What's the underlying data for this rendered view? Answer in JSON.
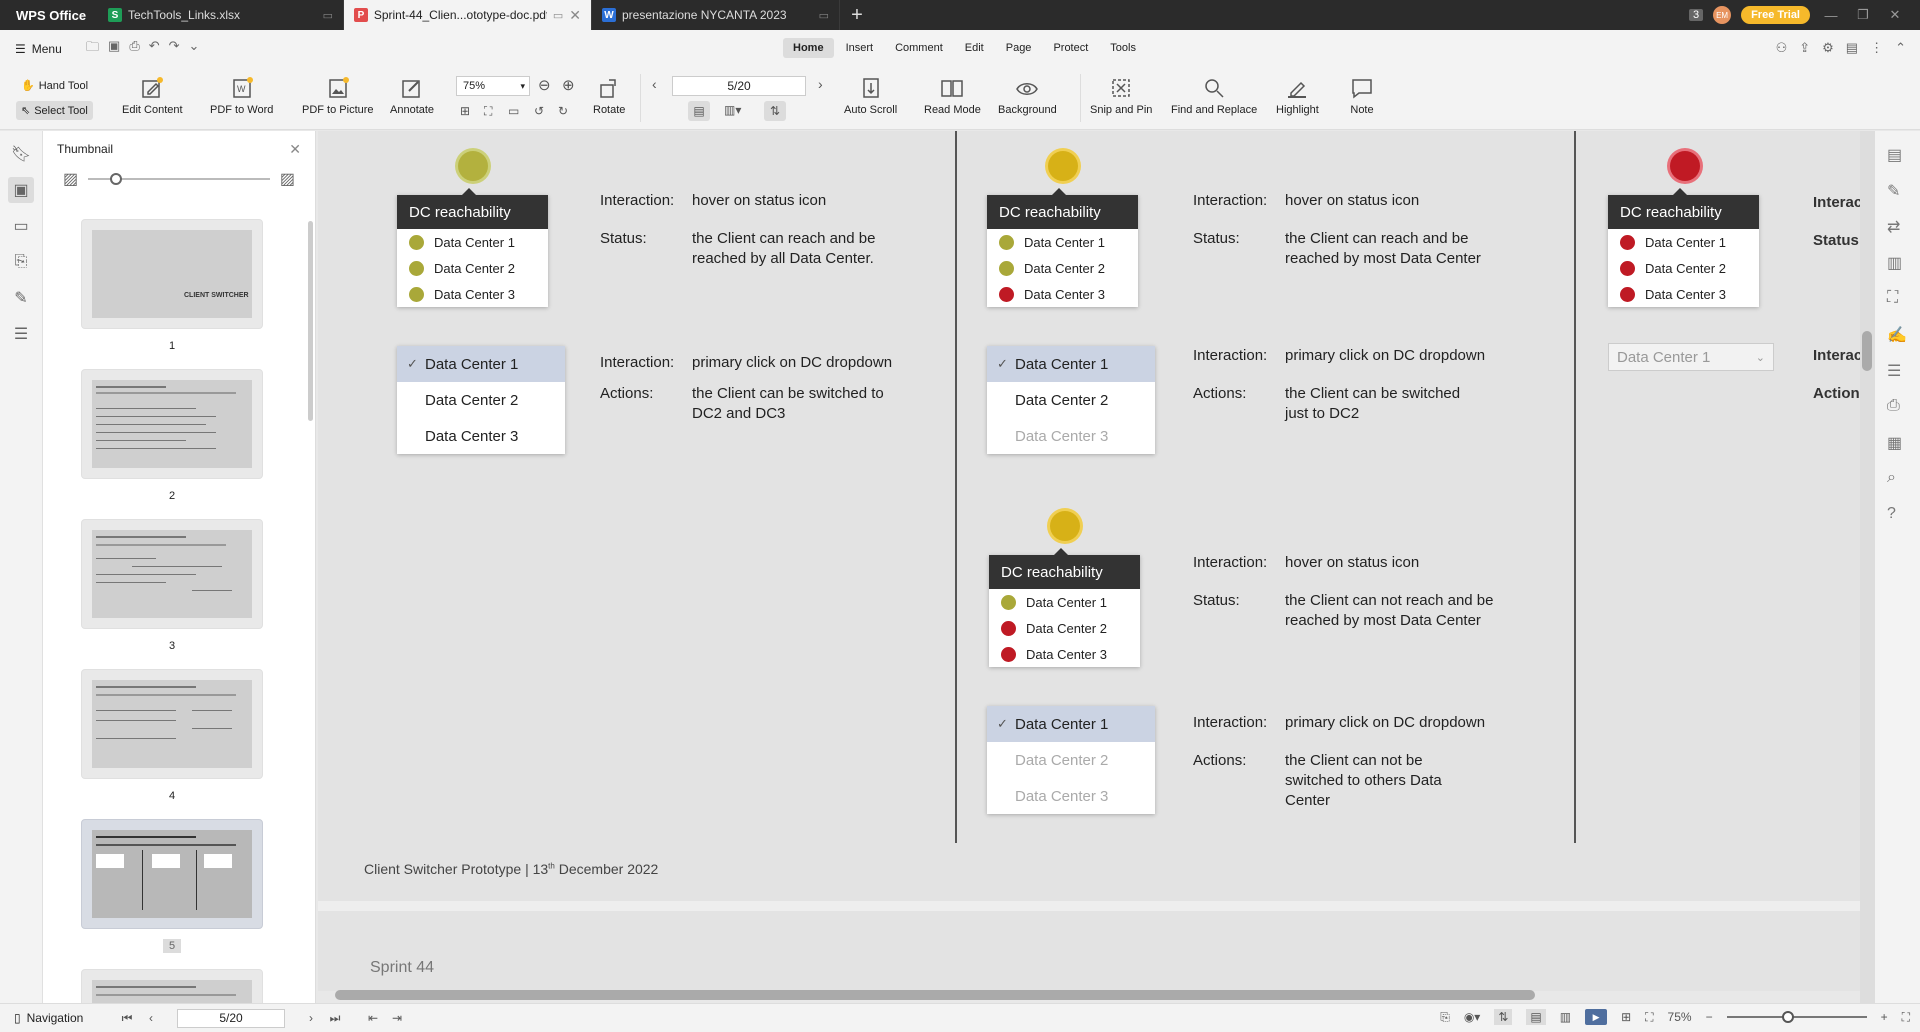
{
  "tabbar": {
    "app_name": "WPS Office",
    "tabs": [
      {
        "label": "TechTools_Links.xlsx",
        "icon": "spreadsheet-icon",
        "color": "#1e9d57"
      },
      {
        "label": "Sprint-44_Clien...ototype-doc.pdf",
        "icon": "pdf-icon",
        "color": "#e24d4d"
      },
      {
        "label": "presentazione NYCANTA 2023",
        "icon": "word-icon",
        "color": "#2b6fd6"
      }
    ],
    "window_count": "3",
    "avatar_initials": "EM",
    "free_trial": "Free Trial"
  },
  "menubar": {
    "menu_label": "Menu",
    "ribbon_tabs": [
      "Home",
      "Insert",
      "Comment",
      "Edit",
      "Page",
      "Protect",
      "Tools"
    ],
    "active_tab": "Home"
  },
  "toolbar": {
    "hand_tool": "Hand Tool",
    "select_tool": "Select Tool",
    "edit_content": "Edit Content",
    "pdf_to_word": "PDF to Word",
    "pdf_to_picture": "PDF to Picture",
    "annotate": "Annotate",
    "zoom": "75%",
    "rotate": "Rotate",
    "page_indicator": "5/20",
    "auto_scroll": "Auto Scroll",
    "read_mode": "Read Mode",
    "background": "Background",
    "snip_and_pin": "Snip and Pin",
    "find_and_replace": "Find and Replace",
    "highlight": "Highlight",
    "note": "Note"
  },
  "thumbnails": {
    "title": "Thumbnail",
    "pages": [
      "1",
      "2",
      "3",
      "4",
      "5"
    ],
    "active_page": "5",
    "page1_title": "CLIENT SWITCHER"
  },
  "document": {
    "popup_title": "DC reachability",
    "data_centers": [
      "Data Center 1",
      "Data Center 2",
      "Data Center 3"
    ],
    "dropdown_value": "Data Center 1",
    "scenario1": {
      "status_colors": [
        "green",
        "green",
        "green"
      ],
      "int1_key": "Interaction:",
      "int1_val": "hover on status icon",
      "status_key": "Status:",
      "status_val": "the Client can reach and be reached by all Data Center.",
      "int2_key": "Interaction:",
      "int2_val": "primary click on DC dropdown",
      "actions_key": "Actions:",
      "actions_val": "the Client can be switched to DC2 and DC3"
    },
    "scenario2": {
      "status_colors": [
        "green",
        "green",
        "red"
      ],
      "int1_key": "Interaction:",
      "int1_val": "hover on status icon",
      "status_key": "Status:",
      "status_val": "the Client can reach and be reached by most Data Center",
      "int2_key": "Interaction:",
      "int2_val": "primary click on DC dropdown",
      "actions_key": "Actions:",
      "actions_val": "the Client can be switched just to DC2"
    },
    "scenario3": {
      "status_colors": [
        "green",
        "red",
        "red"
      ],
      "int1_key": "Interaction:",
      "int1_val": "hover on status icon",
      "status_key": "Status:",
      "status_val": "the Client can not reach and be reached by most Data Center",
      "int2_key": "Interaction:",
      "int2_val": "primary click on DC dropdown",
      "actions_key": "Actions:",
      "actions_val": "the Client can not be switched to others Data Center"
    },
    "scenario4": {
      "status_colors": [
        "red",
        "red",
        "red"
      ],
      "int1_key": "Interac",
      "status_key": "Status:",
      "int2_key": "Interac",
      "actions_key": "Action"
    },
    "footer": "Client Switcher Prototype | 13",
    "footer_sup": "th",
    "footer_tail": " December 2022",
    "next_page_text": "Sprint 44"
  },
  "statusbar": {
    "navigation": "Navigation",
    "page": "5/20",
    "zoom": "75%"
  },
  "colors": {
    "green": "#a9a839",
    "yellow": "#d7b117",
    "red": "#bf1a24",
    "selection": "#cbd3e3"
  }
}
